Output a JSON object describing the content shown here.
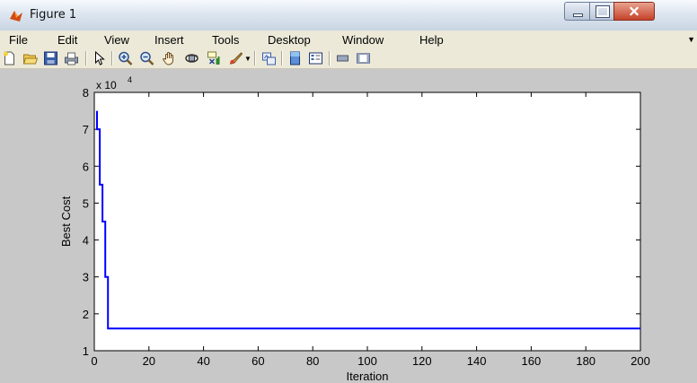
{
  "window": {
    "title": "Figure 1"
  },
  "menu": {
    "items": [
      "File",
      "Edit",
      "View",
      "Insert",
      "Tools",
      "Desktop",
      "Window",
      "Help"
    ]
  },
  "toolbar": {
    "icons": [
      "new-figure-icon",
      "open-file-icon",
      "save-icon",
      "print-icon",
      "pointer-icon",
      "zoom-in-icon",
      "zoom-out-icon",
      "pan-icon",
      "rotate-3d-icon",
      "data-cursor-icon",
      "brush-icon",
      "brush-dropdown-icon",
      "link-plot-icon",
      "colorbar-icon",
      "legend-icon",
      "hide-plot-tools-icon",
      "show-plot-tools-icon"
    ]
  },
  "colors": {
    "line": "#0000ff",
    "figure_bg": "#c8c8c8",
    "axes_bg": "#ffffff"
  },
  "chart_data": {
    "type": "line",
    "title": "",
    "xlabel": "Iteration",
    "ylabel": "Best Cost",
    "y_exponent_label": "x 10",
    "y_exponent_power": "4",
    "xlim": [
      0,
      200
    ],
    "ylim": [
      10000,
      80000
    ],
    "x_ticks": [
      0,
      20,
      40,
      60,
      80,
      100,
      120,
      140,
      160,
      180,
      200
    ],
    "y_ticks": [
      10000,
      20000,
      30000,
      40000,
      50000,
      60000,
      70000,
      80000
    ],
    "y_tick_labels": [
      "1",
      "2",
      "3",
      "4",
      "5",
      "6",
      "7",
      "8"
    ],
    "grid": false,
    "series": [
      {
        "x": [
          1,
          1,
          2,
          2,
          3,
          3,
          4,
          4,
          5,
          5,
          200
        ],
        "y": [
          75000,
          70000,
          70000,
          55000,
          55000,
          45000,
          45000,
          30000,
          30000,
          16000,
          16000
        ]
      }
    ]
  }
}
